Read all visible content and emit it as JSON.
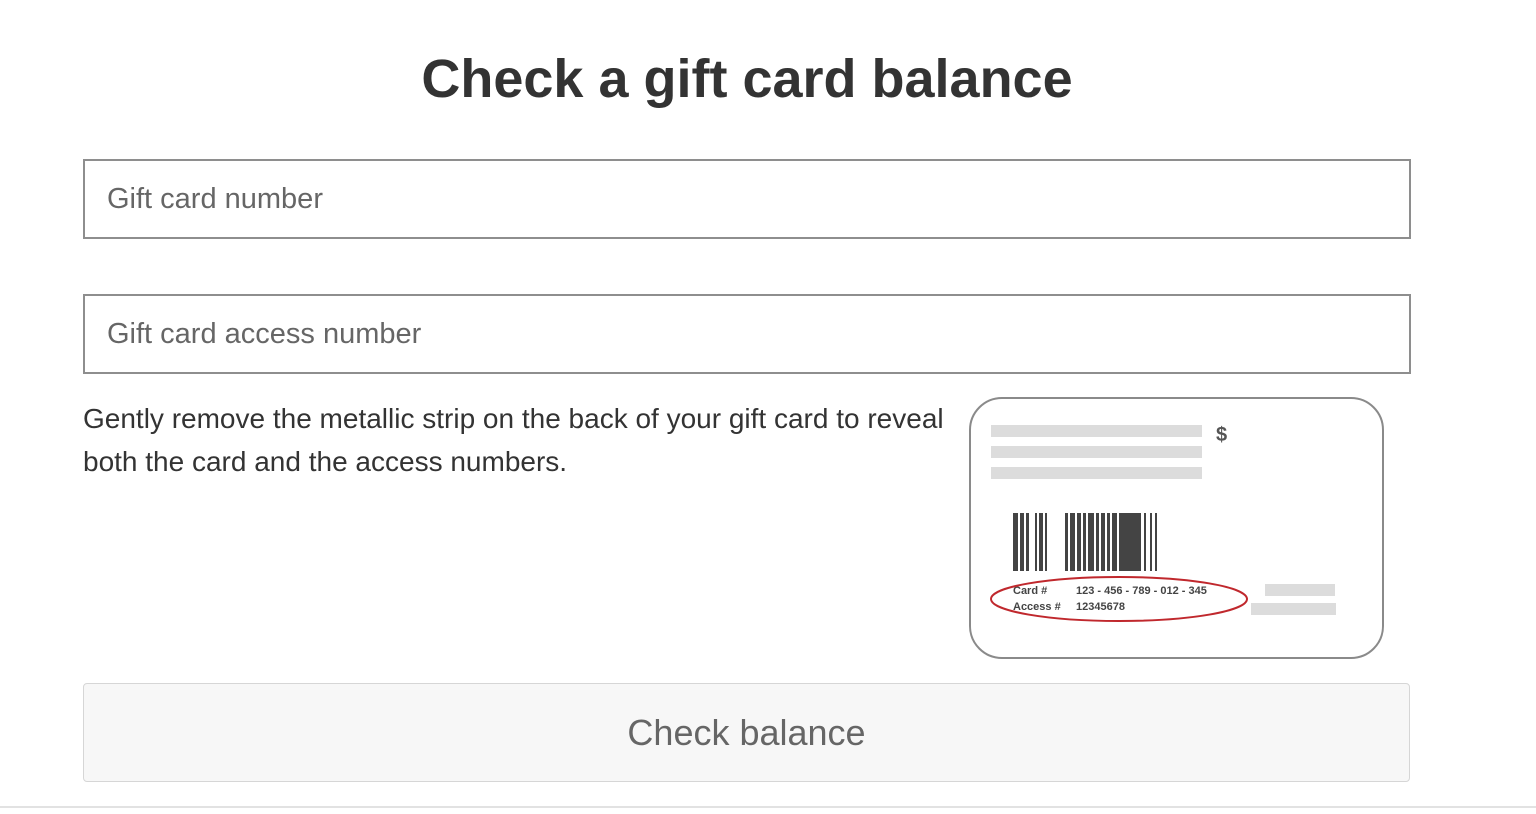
{
  "heading": "Check a gift card balance",
  "form": {
    "card_number_placeholder": "Gift card number",
    "access_number_placeholder": "Gift card access number",
    "help_text": "Gently remove the metallic strip on the back of your gift card to reveal both the card and the access numbers.",
    "submit_label": "Check balance"
  },
  "card_illustration": {
    "currency_symbol": "$",
    "card_label": "Card #",
    "card_number": "123 - 456 - 789 - 012 - 345",
    "access_label": "Access #",
    "access_number": "12345678",
    "highlight_color": "#c0282d"
  }
}
